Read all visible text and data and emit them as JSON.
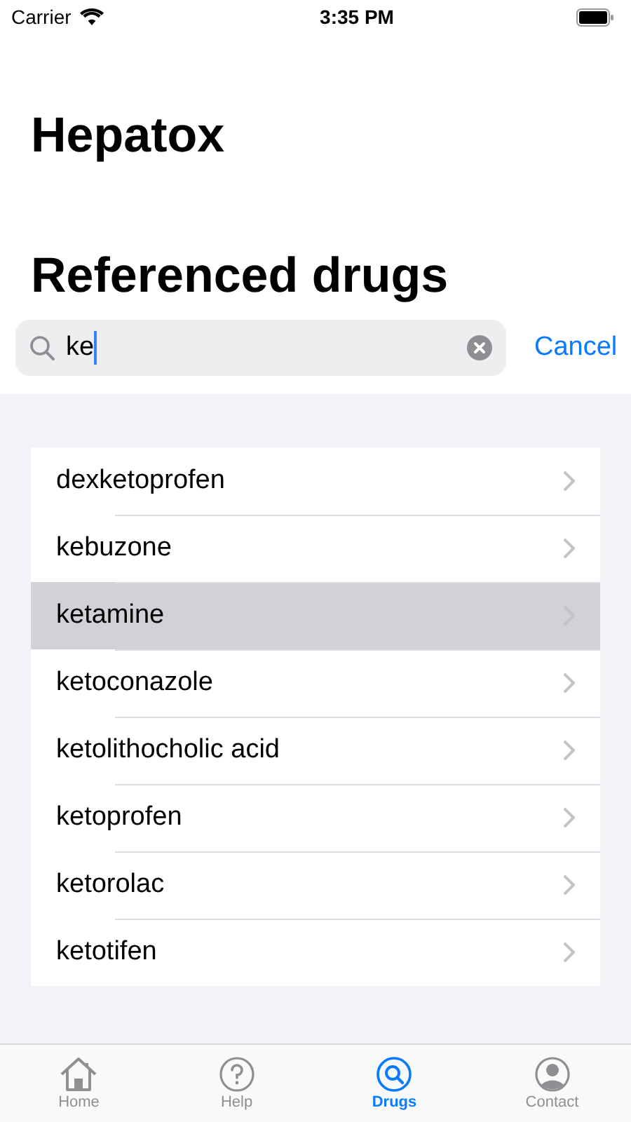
{
  "status_bar": {
    "carrier": "Carrier",
    "time": "3:35 PM"
  },
  "app_title": "Hepatox",
  "section_title": "Referenced drugs",
  "search": {
    "value": "ke",
    "cancel": "Cancel"
  },
  "drugs": [
    {
      "name": "dexketoprofen",
      "selected": false
    },
    {
      "name": "kebuzone",
      "selected": false
    },
    {
      "name": "ketamine",
      "selected": true
    },
    {
      "name": "ketoconazole",
      "selected": false
    },
    {
      "name": "ketolithocholic acid",
      "selected": false
    },
    {
      "name": "ketoprofen",
      "selected": false
    },
    {
      "name": "ketorolac",
      "selected": false
    },
    {
      "name": "ketotifen",
      "selected": false
    }
  ],
  "tabs": [
    {
      "label": "Home",
      "kind": "home",
      "selected": false
    },
    {
      "label": "Help",
      "kind": "help",
      "selected": false
    },
    {
      "label": "Drugs",
      "kind": "search",
      "selected": true
    },
    {
      "label": "Contact",
      "kind": "person",
      "selected": false
    }
  ]
}
